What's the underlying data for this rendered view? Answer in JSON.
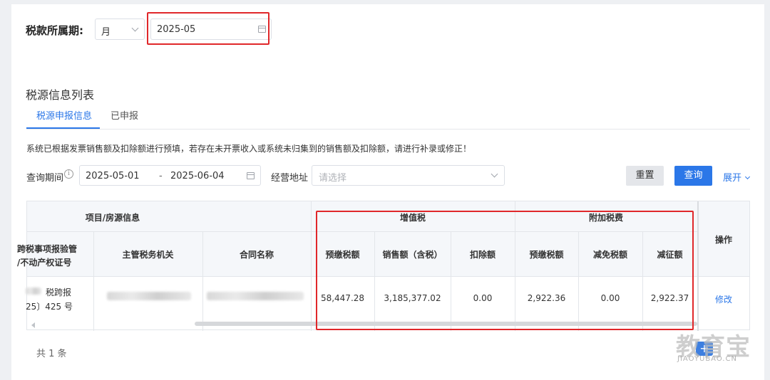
{
  "period": {
    "label": "税款所属期:",
    "type_value": "月",
    "date_value": "2025-05"
  },
  "section_title": "税源信息列表",
  "tabs": [
    {
      "label": "税源申报信息"
    },
    {
      "label": "已申报"
    }
  ],
  "notice": "系统已根据发票销售额及扣除额进行预填，若存在未开票收入或系统未归集到的销售额及扣除额，请进行补录或修正！",
  "query": {
    "period_label": "查询期间",
    "start": "2025-05-01",
    "separator": "-",
    "end": "2025-06-04",
    "address_label": "经营地址",
    "address_placeholder": "请选择",
    "reset_label": "重置",
    "query_label": "查询",
    "expand_label": "展开"
  },
  "table": {
    "group_headers": {
      "project": "项目/房源信息",
      "vat": "增值税",
      "surcharge": "附加税费"
    },
    "columns": {
      "cert_line1": "跨税事项报验管",
      "cert_line2": "/不动产权证号",
      "authority": "主管税务机关",
      "contract": "合同名称",
      "prepaid_tax": "预缴税额",
      "sales": "销售额（含税）",
      "deduction": "扣除额",
      "surcharge_prepaid": "预缴税额",
      "exempt": "减免税额",
      "levy": "减征额",
      "action": "操作"
    },
    "row": {
      "cert_line1": "税跨报",
      "cert_line2": "25〕425 号",
      "prepaid_tax": "58,447.28",
      "sales": "3,185,377.02",
      "deduction": "0.00",
      "surcharge_prepaid": "2,922.36",
      "exempt": "0.00",
      "levy": "2,922.37",
      "action": "修改"
    }
  },
  "total": "共 1 条",
  "watermark": {
    "text": "教育宝",
    "sub": "JIAOYUBAO.CN"
  },
  "colors": {
    "primary": "#2b77e8",
    "highlight": "#e0272a"
  }
}
